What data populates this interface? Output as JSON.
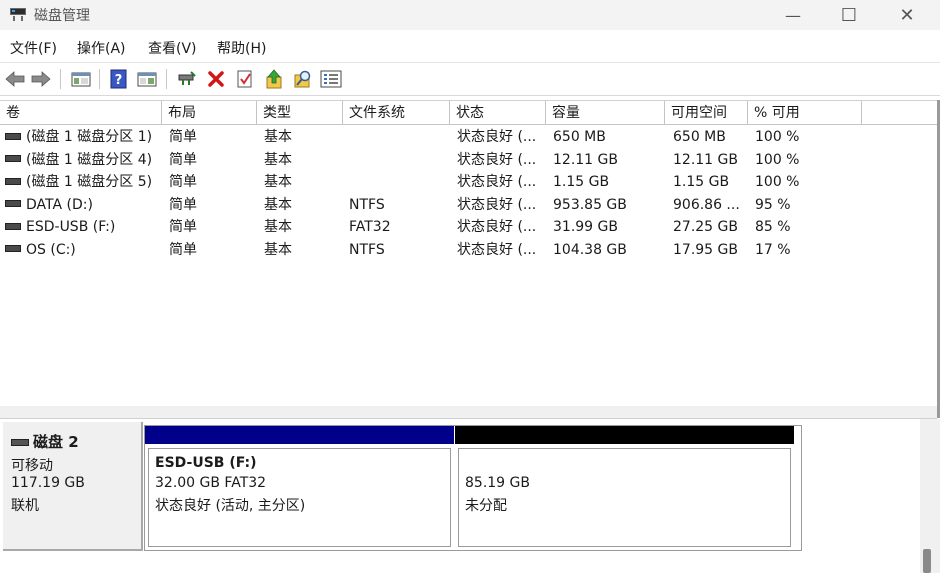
{
  "window": {
    "title": "磁盘管理",
    "min": "—",
    "max": "☐",
    "close": "✕"
  },
  "menu": [
    "文件(F)",
    "操作(A)",
    "查看(V)",
    "帮助(H)"
  ],
  "toolbar": [
    "back-arrow-icon",
    "forward-arrow-icon",
    "show-hide-console-tree-icon",
    "help-icon",
    "properties-panel-icon",
    "connect-disk-icon",
    "delete-icon",
    "check-icon",
    "up-arrow-icon",
    "search-icon",
    "list-view-icon"
  ],
  "columns": [
    "卷",
    "布局",
    "类型",
    "文件系统",
    "状态",
    "容量",
    "可用空间",
    "% 可用"
  ],
  "volumes": [
    {
      "name": "(磁盘 1 磁盘分区 1)",
      "layout": "简单",
      "type": "基本",
      "fs": "",
      "status": "状态良好 (...",
      "capacity": "650 MB",
      "free": "650 MB",
      "pct": "100 %"
    },
    {
      "name": "(磁盘 1 磁盘分区 4)",
      "layout": "简单",
      "type": "基本",
      "fs": "",
      "status": "状态良好 (...",
      "capacity": "12.11 GB",
      "free": "12.11 GB",
      "pct": "100 %"
    },
    {
      "name": "(磁盘 1 磁盘分区 5)",
      "layout": "简单",
      "type": "基本",
      "fs": "",
      "status": "状态良好 (...",
      "capacity": "1.15 GB",
      "free": "1.15 GB",
      "pct": "100 %"
    },
    {
      "name": "DATA (D:)",
      "layout": "简单",
      "type": "基本",
      "fs": "NTFS",
      "status": "状态良好 (...",
      "capacity": "953.85 GB",
      "free": "906.86 ...",
      "pct": "95 %"
    },
    {
      "name": "ESD-USB (F:)",
      "layout": "简单",
      "type": "基本",
      "fs": "FAT32",
      "status": "状态良好 (...",
      "capacity": "31.99 GB",
      "free": "27.25 GB",
      "pct": "85 %"
    },
    {
      "name": "OS (C:)",
      "layout": "简单",
      "type": "基本",
      "fs": "NTFS",
      "status": "状态良好 (...",
      "capacity": "104.38 GB",
      "free": "17.95 GB",
      "pct": "17 %"
    }
  ],
  "disk": {
    "name": "磁盘 2",
    "kind": "可移动",
    "size": "117.19 GB",
    "state": "联机",
    "partitions": [
      {
        "label": "ESD-USB  (F:)",
        "size": "32.00 GB FAT32",
        "status": "状态良好 (活动, 主分区)",
        "bar_color": "#00008b"
      },
      {
        "size": "85.19 GB",
        "status": "未分配",
        "bar_color": "#000000"
      }
    ]
  }
}
